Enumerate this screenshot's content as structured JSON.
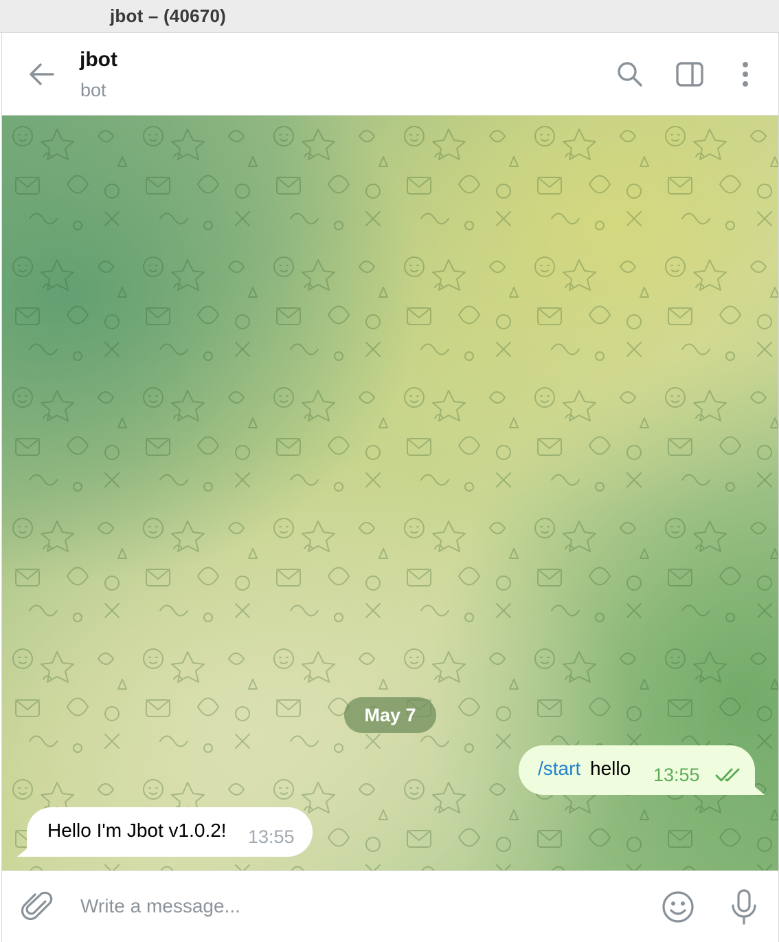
{
  "window": {
    "title": "jbot – (40670)"
  },
  "header": {
    "chat_name": "jbot",
    "status": "bot",
    "icons": [
      "back-arrow-icon",
      "search-icon",
      "sidebar-toggle-icon",
      "more-vertical-icon"
    ]
  },
  "chat": {
    "date_label": "May 7",
    "messages": [
      {
        "direction": "outgoing",
        "command": "/start",
        "text": "hello",
        "time": "13:55",
        "status": "read",
        "status_icon": "double-check-icon"
      },
      {
        "direction": "incoming",
        "text": "Hello I'm Jbot v1.0.2!",
        "time": "13:55"
      }
    ]
  },
  "composer": {
    "placeholder": "Write a message...",
    "value": "",
    "icons": [
      "paperclip-icon",
      "emoji-icon",
      "microphone-icon"
    ]
  },
  "colors": {
    "accent": "#2481cc",
    "outgoing_bubble": "#effdde",
    "outgoing_time": "#5cab58",
    "incoming_bubble": "#ffffff",
    "date_pill": "#6e8c5a"
  }
}
